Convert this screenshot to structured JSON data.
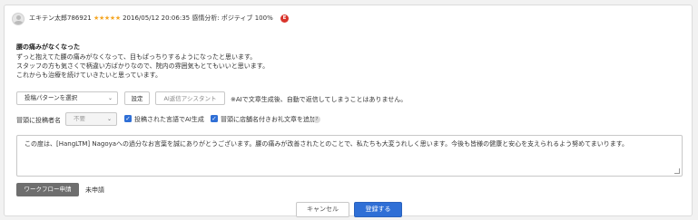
{
  "review": {
    "reviewer_name": "エキテン太郎786921",
    "stars": "★★★★★",
    "date": "2016/05/12 20:06:35",
    "sentiment": "感情分析: ポジティブ 100%",
    "lang_badge": "E",
    "title": "腰の痛みがなくなった",
    "lines": [
      "ずっと抱えてた腰の痛みがなくなって、目もぱっちりするようになったと思います。",
      "スタッフの方も気さくで柄違い方ばかりなので、院内の雰囲気もとてもいいと思います。",
      "これからも治療を続けていきたいと思っています。"
    ]
  },
  "controls": {
    "post_pattern": {
      "value": "投稿パターンを選択",
      "icon": "chevron-down-icon"
    },
    "settings_label": "設定",
    "ai_assistant_label": "AI返信アシスタント",
    "ai_note": "※AIで文章生成後、自動で返信してしまうことはありません。",
    "signature_label": "冒頭に投稿者名",
    "signature_select": {
      "value": "不要",
      "icon": "chevron-down-icon"
    },
    "check_ai_language": "投稿された言語でAI生成",
    "check_store_name": "冒頭に店舗名付きお礼文章を追加",
    "help_glyph": "?"
  },
  "reply": {
    "text": "この度は、[HangLTM] Nagoyaへの過分なお言葉を誠にありがとうございます。腰の痛みが改善されたとのことで、私たちも大変うれしく思います。今後も皆様の健康と安心を支えられるよう努めてまいります。"
  },
  "workflow": {
    "button_label": "ワークフロー申請",
    "status": "未申請"
  },
  "footer": {
    "cancel_label": "キャンセル",
    "submit_label": "登録する"
  },
  "colors": {
    "accent": "#2f6fd6",
    "star": "#f5a623",
    "badge": "#d9342b"
  }
}
